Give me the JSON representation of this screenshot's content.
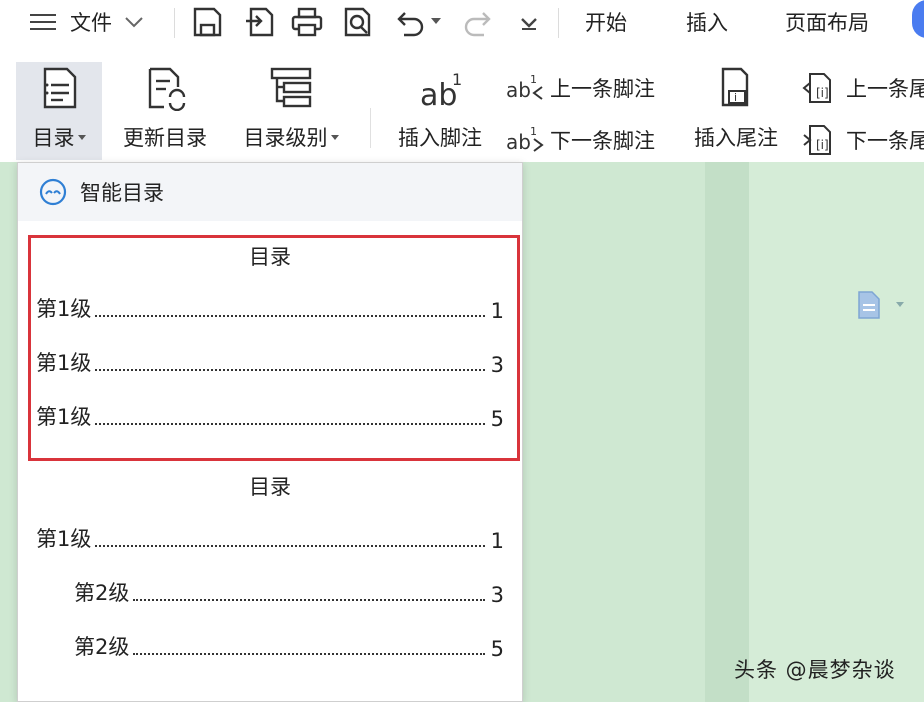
{
  "menubar": {
    "file_label": "文件",
    "tabs": [
      "开始",
      "插入",
      "页面布局"
    ]
  },
  "ribbon": {
    "toc_label": "目录",
    "update_toc_label": "更新目录",
    "toc_level_label": "目录级别",
    "insert_footnote_label": "插入脚注",
    "prev_footnote_label": "上一条脚注",
    "next_footnote_label": "下一条脚注",
    "insert_endnote_label": "插入尾注",
    "prev_endnote_label": "上一条尾注",
    "next_endnote_label": "下一条尾注"
  },
  "dropdown": {
    "smart_toc_label": "智能目录",
    "templates": [
      {
        "title": "目录",
        "entries": [
          {
            "text": "第1级",
            "page": "1"
          },
          {
            "text": "第1级",
            "page": "3"
          },
          {
            "text": "第1级",
            "page": "5"
          }
        ]
      },
      {
        "title": "目录",
        "entries": [
          {
            "text": "第1级",
            "page": "1"
          },
          {
            "text": "第2级",
            "page": "3"
          },
          {
            "text": "第2级",
            "page": "5"
          }
        ]
      }
    ]
  },
  "watermark": "头条 @晨梦杂谈",
  "colors": {
    "highlight_border": "#d9343b",
    "document_background": "#cfe8d2",
    "active_button_bg": "#e3e6ec",
    "account_blue": "#4a7cf0"
  }
}
